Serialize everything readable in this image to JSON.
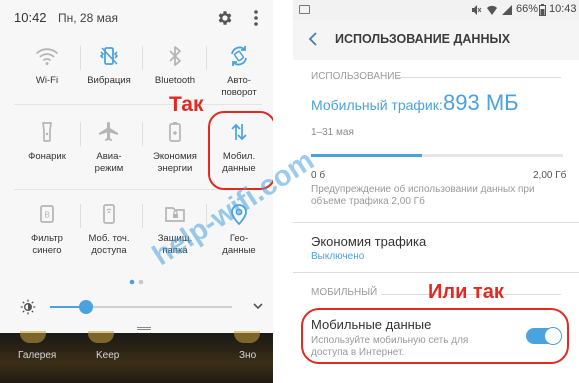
{
  "left_panel": {
    "status": {
      "time": "10:42",
      "date": "Пн, 28 мая"
    },
    "tiles": [
      {
        "label": "Wi-Fi",
        "icon": "wifi-icon"
      },
      {
        "label": "Вибрация",
        "icon": "vibration-icon"
      },
      {
        "label": "Bluetooth",
        "icon": "bluetooth-icon"
      },
      {
        "label": "Авто-\nповорот",
        "icon": "autorotate-icon"
      },
      {
        "label": "Фонарик",
        "icon": "flashlight-icon"
      },
      {
        "label": "Авиа-\nрежим",
        "icon": "airplane-icon"
      },
      {
        "label": "Экономия\nэнергии",
        "icon": "battery-saver-icon"
      },
      {
        "label": "Мобил.\nданные",
        "icon": "mobile-data-icon"
      },
      {
        "label": "Фильтр\nсинего",
        "icon": "blue-filter-icon"
      },
      {
        "label": "Моб. точ.\nдоступа",
        "icon": "hotspot-icon"
      },
      {
        "label": "Защищ.\nпапка",
        "icon": "secure-folder-icon"
      },
      {
        "label": "Гео-\nданные",
        "icon": "location-icon"
      }
    ],
    "brightness_level": 0.2,
    "dock": [
      {
        "label": "Галерея"
      },
      {
        "label": "Keep"
      },
      {
        "label": "Зно"
      }
    ],
    "annotation": "Так"
  },
  "right_panel": {
    "status": {
      "battery_percent": "66%",
      "time": "10:43"
    },
    "header_title": "ИСПОЛЬЗОВАНИЕ ДАННЫХ",
    "usage_section": {
      "label": "ИСПОЛЬЗОВАНИЕ",
      "traffic_label": "Мобильный трафик:",
      "traffic_value": "893 МБ",
      "period": "1–31 мая",
      "bar_fraction": 0.44,
      "min": "0 б",
      "max": "2,00 Гб",
      "warning": "Предупреждение об использовании данных при объеме трафика 2,00 Гб"
    },
    "saver": {
      "title": "Экономия трафика",
      "subtitle": "Выключено"
    },
    "mobile_section": {
      "label": "МОБИЛЬНЫЙ",
      "title": "Мобильные данные",
      "subtitle": "Используйте мобильную сеть для доступа в Интернет.",
      "enabled": true
    },
    "annotation": "Или так"
  },
  "watermark": "help-wifi.com",
  "colors": {
    "accent": "#4aa3df",
    "annotation": "#e12a22"
  }
}
